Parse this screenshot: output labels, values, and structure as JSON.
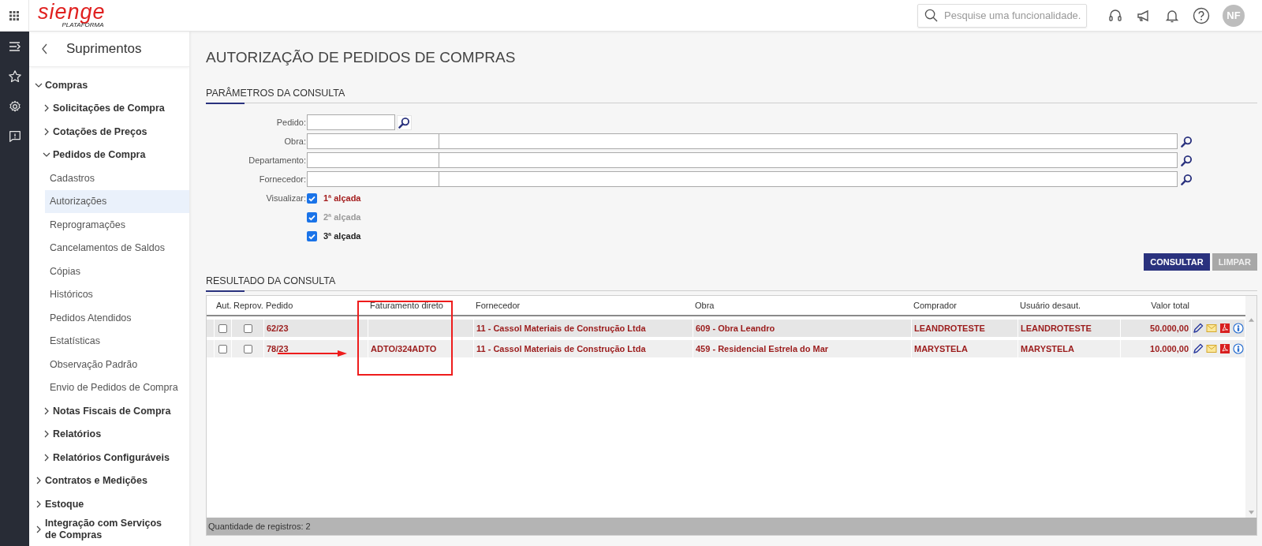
{
  "topbar": {
    "logo": {
      "word": "sienge",
      "tagline": "PLATAFORMA"
    },
    "search": {
      "placeholder": "Pesquise uma funcionalidade."
    },
    "avatar": "NF"
  },
  "sidebar": {
    "title": "Suprimentos",
    "tree": [
      {
        "label": "Compras",
        "expanded": true,
        "children": [
          {
            "label": "Solicitações de Compra",
            "expanded": false
          },
          {
            "label": "Cotações de Preços",
            "expanded": false
          },
          {
            "label": "Pedidos de Compra",
            "expanded": true,
            "children": [
              {
                "label": "Cadastros",
                "selected": false
              },
              {
                "label": "Autorizações",
                "selected": true
              },
              {
                "label": "Reprogramações",
                "selected": false
              },
              {
                "label": "Cancelamentos de Saldos",
                "selected": false
              },
              {
                "label": "Cópias",
                "selected": false
              },
              {
                "label": "Históricos",
                "selected": false
              },
              {
                "label": "Pedidos Atendidos",
                "selected": false
              },
              {
                "label": "Estatísticas",
                "selected": false
              },
              {
                "label": "Observação Padrão",
                "selected": false
              },
              {
                "label": "Envio de Pedidos de Compra",
                "selected": false
              }
            ]
          },
          {
            "label": "Notas Fiscais de Compra",
            "expanded": false
          },
          {
            "label": "Relatórios",
            "expanded": false
          },
          {
            "label": "Relatórios Configuráveis",
            "expanded": false
          }
        ]
      },
      {
        "label": "Contratos e Medições",
        "expanded": false
      },
      {
        "label": "Estoque",
        "expanded": false
      },
      {
        "label": "Integração com Serviços de Compras",
        "expanded": false
      }
    ]
  },
  "page_title": "AUTORIZAÇÃO DE PEDIDOS DE COMPRAS",
  "query": {
    "heading": "PARÂMETROS DA CONSULTA",
    "fields": [
      {
        "label": "Pedido:",
        "kind": "single"
      },
      {
        "label": "Obra:",
        "kind": "pair"
      },
      {
        "label": "Departamento:",
        "kind": "pair"
      },
      {
        "label": "Fornecedor:",
        "kind": "pair"
      }
    ],
    "view": {
      "label": "Visualizar:",
      "options": [
        {
          "label": "1ª alçada",
          "checked": true,
          "color": "#a31c1c"
        },
        {
          "label": "2ª alçada",
          "checked": true,
          "color": "#9a9a9a"
        },
        {
          "label": "3ª alçada",
          "checked": true,
          "color": "#1e1e1e"
        }
      ]
    },
    "buttons": [
      {
        "label": "CONSULTAR",
        "disabled": false
      },
      {
        "label": "LIMPAR",
        "disabled": true
      }
    ]
  },
  "results": {
    "heading": "RESULTADO DA CONSULTA",
    "columns": [
      "Aut.",
      "Reprov.",
      "Pedido",
      "Faturamento direto",
      "Fornecedor",
      "Obra",
      "Comprador",
      "Usuário desaut.",
      "Valor total"
    ],
    "rows": [
      {
        "cells": [
          {
            "kind": "checkbox",
            "checked": false
          },
          {
            "kind": "checkbox",
            "checked": false
          },
          "62/23",
          "",
          "11 - Cassol Materiais de Construção Ltda",
          "609 - Obra Leandro",
          "LEANDROTESTE",
          "LEANDROTESTE",
          "50.000,00"
        ]
      },
      {
        "cells": [
          {
            "kind": "checkbox",
            "checked": false
          },
          {
            "kind": "checkbox",
            "checked": false
          },
          "78/23",
          "ADTO/324ADTO",
          "11 - Cassol Materiais de Construção Ltda",
          "459 - Residencial Estrela do Mar",
          "MARYSTELA",
          "MARYSTELA",
          "10.000,00"
        ]
      }
    ],
    "footer": "Quantidade de registros: 2"
  },
  "annotations": {
    "box": true,
    "arrow": true
  }
}
